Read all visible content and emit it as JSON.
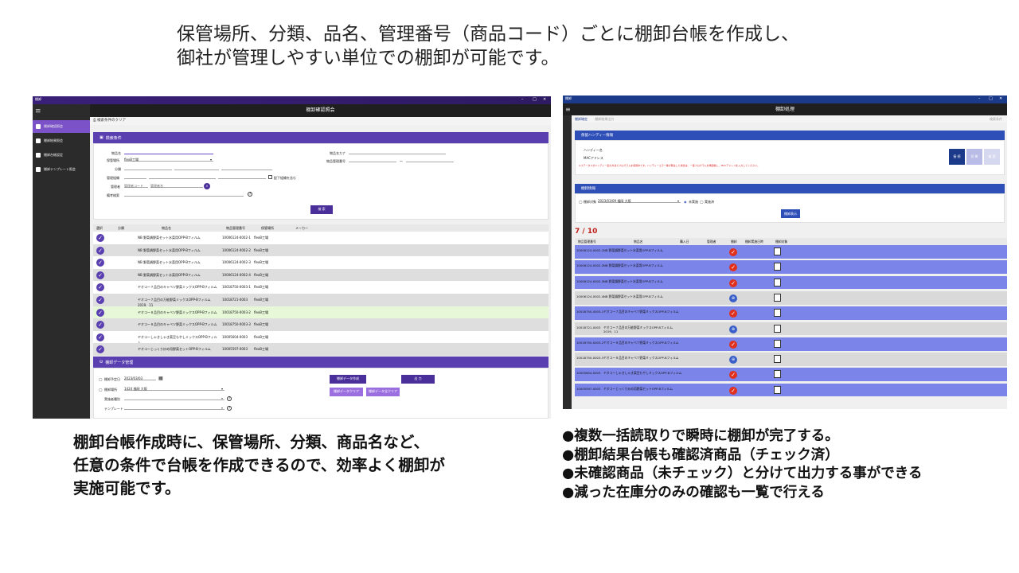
{
  "header": {
    "line1": "保管場所、分類、品名、管理番号（商品コード）ごとに棚卸台帳を作成し、",
    "line2": "御社が管理しやすい単位での棚卸が可能です。"
  },
  "left_caption": {
    "line1": "棚卸台帳作成時に、保管場所、分類、商品名など、",
    "line2": "任意の条件で台帳を作成できるので、効率よく棚卸が",
    "line3": "実施可能です。"
  },
  "right_caption": {
    "line1": "●複数一括読取りで瞬時に棚卸が完了する。",
    "line2": "●棚卸結果台帳も確認済商品（チェック済）",
    "line3": "●未確認商品（未チェック）と分けて出力する事ができる",
    "line4": "●減った在庫分のみの確認も一覧で行える"
  },
  "left_app": {
    "window_title": "棚卸",
    "title": "棚卸確認照会",
    "sidebar": [
      {
        "label": "棚卸確認照会",
        "active": true
      },
      {
        "label": "棚卸結果照会",
        "active": false
      },
      {
        "label": "棚卸台帳設定",
        "active": false
      },
      {
        "label": "棚卸テンプレート照会",
        "active": false
      }
    ],
    "toolbar_clear": "検索条件のクリア",
    "search_section": "検索条件",
    "fields": {
      "item_name": "物品名",
      "storage": "保管場所",
      "storage_value": "flexB工場",
      "category": "分類",
      "mgmt_org": "管理組織",
      "manager": "管理者",
      "manager_ph1": "管理者コード",
      "manager_ph2": "管理者名",
      "remarks": "備考検索",
      "item_kana": "物品名カナ",
      "item_mgmt_no": "物品管理番号",
      "tilde": "～",
      "include_sub": "配下組織を含む"
    },
    "search_button": "検 索",
    "grid_headers": [
      "選択",
      "分類",
      "物品名",
      "物品管理番号",
      "保管場所",
      "メーカー"
    ],
    "rows": [
      {
        "name": "NB 野菜鍋野菜セット水菜用OPP-Bフィルム",
        "no": "10006124-0002-1",
        "place": "flexB工場",
        "highlight": false,
        "shade": false
      },
      {
        "name": "NB 野菜鍋野菜セット水菜用OPP-Bフィルム",
        "no": "10006124-0002-2",
        "place": "flexB工場",
        "highlight": false,
        "shade": true
      },
      {
        "name": "NB 野菜鍋野菜セット水菜用OPP-Bフィルム",
        "no": "10006124-0002-3",
        "place": "flexB工場",
        "highlight": false,
        "shade": false
      },
      {
        "name": "NB 野菜鍋野菜セット水菜用OPP-Bフィルム",
        "no": "10006124-0002-4",
        "place": "flexB工場",
        "highlight": false,
        "shade": true
      },
      {
        "name": "ヤオコー７品目のキャベツ野菜ミックスOPP-Bフィルム",
        "no": "10018750-0003-1",
        "place": "flexB工場",
        "highlight": false,
        "shade": false
      },
      {
        "name": "ヤオコー７品目の万能野菜ミックスOPP-Bフィルム 2019、11",
        "no": "10018721-0003",
        "place": "flexB工場",
        "highlight": false,
        "shade": true
      },
      {
        "name": "ヤオコー８品目のキャベツ野菜ミックスOPP-Bフィルム",
        "no": "10018750-0003-2",
        "place": "flexB工場",
        "highlight": true,
        "shade": false
      },
      {
        "name": "ヤオコー８品目のキャベツ野菜ミックスOPP-Bフィルム",
        "no": "10018750-0003-3",
        "place": "flexB工場",
        "highlight": false,
        "shade": true
      },
      {
        "name": "ヤオコーしゃきしゃき菜豆もやしミックスOPP-Bフィルム",
        "no": "10005604-0003",
        "place": "flexB工場",
        "highlight": false,
        "shade": false
      },
      {
        "name": "ヤオコーじっくり炒め用野菜セットOPP-Bフィルム",
        "no": "10005597-0003",
        "place": "flexB工場",
        "highlight": false,
        "shade": true
      }
    ],
    "data_section": "棚卸データ管理",
    "data_fields": {
      "planned_date": "棚卸予定日",
      "planned_date_value": "2023/03/03",
      "inventory_place": "棚卸場所",
      "inventory_place_value": "1424 福岡 大阪",
      "executor": "実施者種別",
      "template": "テンプレート"
    },
    "buttons": {
      "create": "棚卸データ作成",
      "output": "出 力",
      "clear_data": "棚卸データクリア",
      "clear_all": "棚卸データ全クリア"
    }
  },
  "right_app": {
    "window_title": "棚卸",
    "title": "棚卸処理",
    "toolbar": [
      "棚卸確定",
      "棚卸結果出力"
    ],
    "toolbar_right": "検索条件",
    "reader_section": "保留ハンディー情報",
    "handy_label": "ハンディー名",
    "mac_label": "MACアドレス",
    "warning": "※ステータスがハンディー名の方法でプログラムを使用中です。ハンディーエラー等が発生した場合は、一度プログラムを再起動し、MACアドレスを入力してください。",
    "handy_buttons": [
      "接 続",
      "切 断",
      "検 索"
    ],
    "process_section": "棚卸情報",
    "target_label": "棚卸対象",
    "target_value": "2023/03/09  福岡  大阪",
    "radio1": "未実施",
    "radio2": "実施済",
    "show_button": "棚卸表示",
    "count": "7 / 10",
    "grid_headers": [
      "物品管理番号",
      "物品名",
      "購入日",
      "管理者",
      "棚卸",
      "棚卸実施日時",
      "棚卸対象"
    ],
    "rows": [
      {
        "no": "10006124-0002-1",
        "name": "NB 野菜鍋野菜セット水菜用OPP-Bフィルム",
        "checked": true
      },
      {
        "no": "10006124-0002-2",
        "name": "NB 野菜鍋野菜セット水菜用OPP-Bフィルム",
        "checked": true
      },
      {
        "no": "10006124-0002-3",
        "name": "NB 野菜鍋野菜セット水菜用OPP-Bフィルム",
        "checked": true
      },
      {
        "no": "10006124-0002-4",
        "name": "NB 野菜鍋野菜セット水菜用OPP-Bフィルム",
        "checked": false
      },
      {
        "no": "10018750-0003-1",
        "name": "ヤオコー７品目のキャベツ野菜ミックスOPP-Bフィルム",
        "checked": true
      },
      {
        "no": "10018721-0003",
        "name": "ヤオコー７品目の万能野菜ミックスOPP-Bフィルム 2019、11",
        "checked": false
      },
      {
        "no": "10018750-0003-2",
        "name": "ヤオコー８品目のキャベツ野菜ミックスOPP-Bフィルム",
        "checked": true
      },
      {
        "no": "10018750-0003-3",
        "name": "ヤオコー８品目のキャベツ野菜ミックスOPP-Bフィルム",
        "checked": false
      },
      {
        "no": "10005604-0003",
        "name": "ヤオコーしゃきしゃき菜豆もやしミックスOPP-Bフィルム",
        "checked": true
      },
      {
        "no": "10005597-0003",
        "name": "ヤオコーじっくり炒め用野菜セットOPP-Bフィルム",
        "checked": true
      }
    ],
    "colors": {
      "checked_row": "#7b84e8",
      "unchecked_row": "#d9d9d9",
      "check": "#e0301e"
    }
  }
}
